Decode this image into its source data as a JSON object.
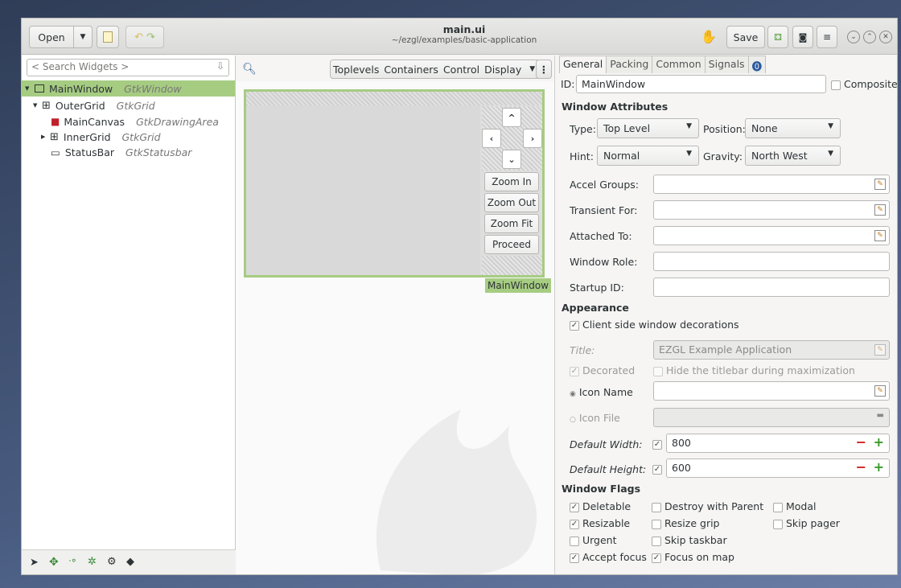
{
  "header": {
    "open_label": "Open",
    "title": "main.ui",
    "subtitle": "~/ezgl/examples/basic-application",
    "save_label": "Save"
  },
  "left": {
    "search_placeholder": "< Search Widgets >",
    "tree": [
      {
        "name": "MainWindow",
        "cls": "GtkWindow"
      },
      {
        "name": "OuterGrid",
        "cls": "GtkGrid"
      },
      {
        "name": "MainCanvas",
        "cls": "GtkDrawingArea"
      },
      {
        "name": "InnerGrid",
        "cls": "GtkGrid"
      },
      {
        "name": "StatusBar",
        "cls": "GtkStatusbar"
      }
    ]
  },
  "middle": {
    "categories": [
      "Toplevels",
      "Containers",
      "Control",
      "Display"
    ],
    "zoom_in": "Zoom In",
    "zoom_out": "Zoom Out",
    "zoom_fit": "Zoom Fit",
    "proceed": "Proceed",
    "window_label": "MainWindow"
  },
  "right": {
    "tabs": [
      "General",
      "Packing",
      "Common",
      "Signals"
    ],
    "id_label": "ID:",
    "id_value": "MainWindow",
    "composite_label": "Composite",
    "window_attributes": "Window Attributes",
    "type_label": "Type:",
    "type_value": "Top Level",
    "position_label": "Position:",
    "position_value": "None",
    "hint_label": "Hint:",
    "hint_value": "Normal",
    "gravity_label": "Gravity:",
    "gravity_value": "North West",
    "accel_groups": "Accel Groups:",
    "transient_for": "Transient For:",
    "attached_to": "Attached To:",
    "window_role": "Window Role:",
    "startup_id": "Startup ID:",
    "appearance": "Appearance",
    "csd_label": "Client side window decorations",
    "title_label": "Title:",
    "title_value": "EZGL Example Application",
    "decorated_label": "Decorated",
    "hide_titlebar_label": "Hide the titlebar during maximization",
    "icon_name_label": "Icon Name",
    "icon_file_label": "Icon File",
    "default_width_label": "Default Width:",
    "default_width_value": "800",
    "default_height_label": "Default Height:",
    "default_height_value": "600",
    "window_flags": "Window Flags",
    "flags": {
      "deletable": "Deletable",
      "destroy_with_parent": "Destroy with Parent",
      "modal": "Modal",
      "resizable": "Resizable",
      "resize_grip": "Resize grip",
      "skip_pager": "Skip pager",
      "urgent": "Urgent",
      "skip_taskbar": "Skip taskbar",
      "accept_focus": "Accept focus",
      "focus_on_map": "Focus on map"
    }
  },
  "colors": {
    "accent_green": "#a6cc82",
    "selection": "#a6cc82"
  }
}
